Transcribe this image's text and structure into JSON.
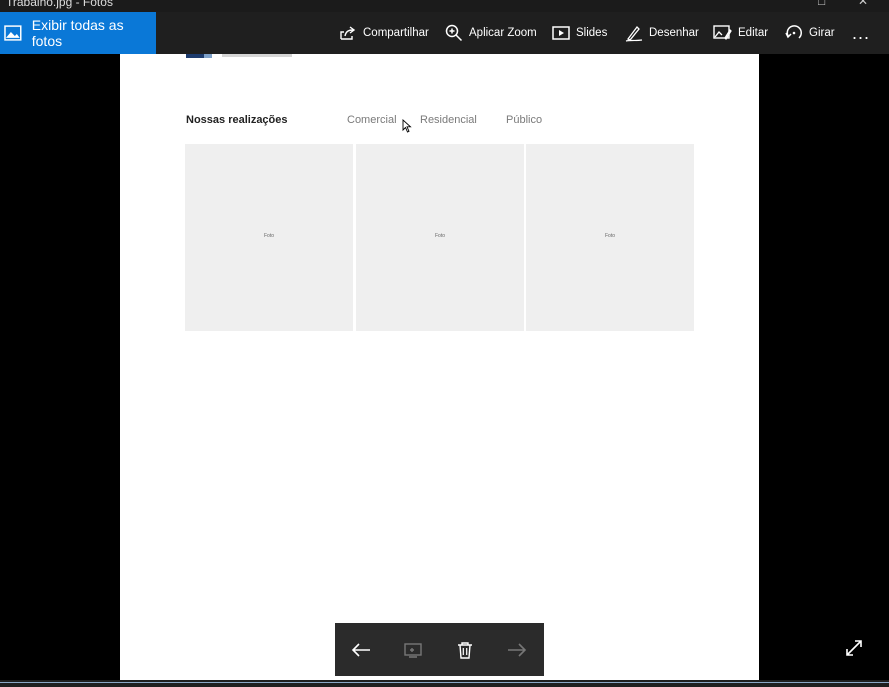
{
  "window": {
    "title": "Trabalho.jpg - Fotos"
  },
  "toolbar": {
    "view_all_label": "Exibir todas as fotos",
    "share_label": "Compartilhar",
    "zoom_label": "Aplicar Zoom",
    "slides_label": "Slides",
    "draw_label": "Desenhar",
    "edit_label": "Editar",
    "rotate_label": "Girar",
    "more_label": "..."
  },
  "page": {
    "heading": "Nossas realizações",
    "nav": [
      "Comercial",
      "Residencial",
      "Público"
    ],
    "photos": [
      {
        "label": "Foto"
      },
      {
        "label": "Foto"
      },
      {
        "label": "Foto"
      }
    ]
  },
  "colors": {
    "accent": "#0a78d7",
    "toolbar": "#1f1f1f",
    "photo_bg": "#efefef"
  }
}
